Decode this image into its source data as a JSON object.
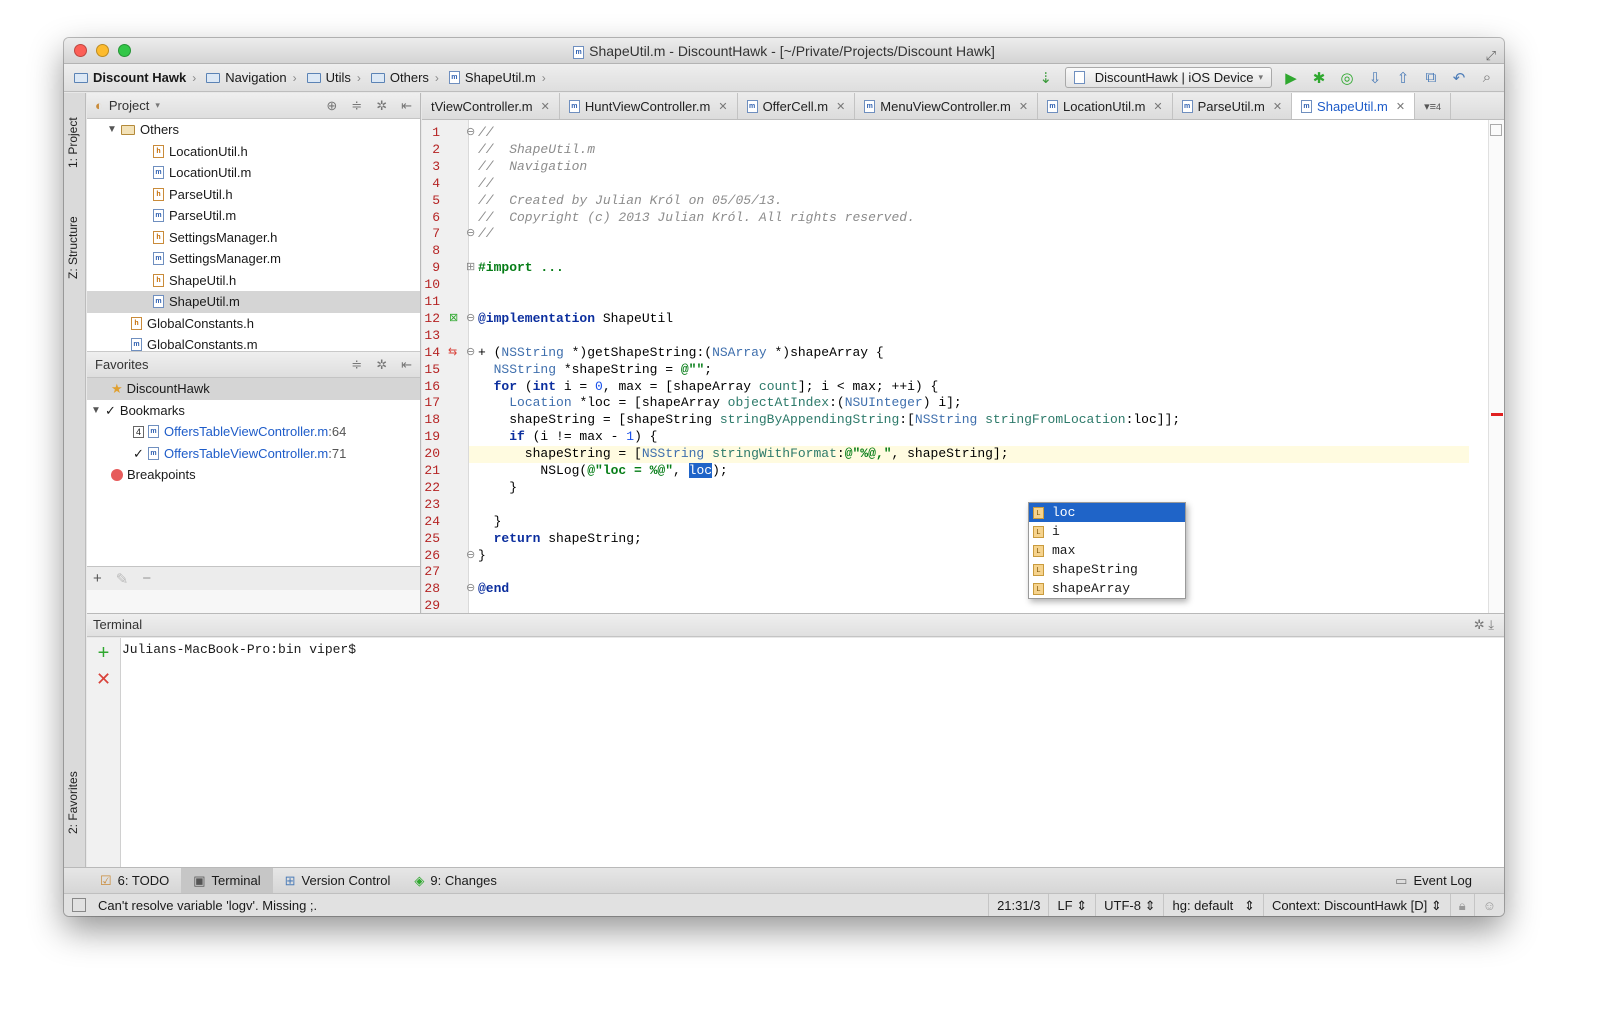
{
  "window": {
    "title": "ShapeUtil.m - DiscountHawk - [~/Private/Projects/Discount Hawk]"
  },
  "breadcrumb": [
    "Discount Hawk",
    "Navigation",
    "Utils",
    "Others",
    "ShapeUtil.m"
  ],
  "run_config": "DiscountHawk | iOS Device",
  "left_strip": {
    "project": "1: Project",
    "structure": "Z: Structure",
    "favorites": "2: Favorites"
  },
  "project_panel": {
    "title": "Project",
    "tree": [
      {
        "label": "Others",
        "kind": "folder",
        "indent": 1
      },
      {
        "label": "LocationUtil.h",
        "kind": "h",
        "indent": 3
      },
      {
        "label": "LocationUtil.m",
        "kind": "m",
        "indent": 3
      },
      {
        "label": "ParseUtil.h",
        "kind": "h",
        "indent": 3
      },
      {
        "label": "ParseUtil.m",
        "kind": "m",
        "indent": 3
      },
      {
        "label": "SettingsManager.h",
        "kind": "h",
        "indent": 3
      },
      {
        "label": "SettingsManager.m",
        "kind": "m",
        "indent": 3
      },
      {
        "label": "ShapeUtil.h",
        "kind": "h",
        "indent": 3
      },
      {
        "label": "ShapeUtil.m",
        "kind": "m",
        "indent": 3,
        "selected": true
      },
      {
        "label": "GlobalConstants.h",
        "kind": "h",
        "indent": 2
      },
      {
        "label": "GlobalConstants.m",
        "kind": "m",
        "indent": 2
      }
    ]
  },
  "favorites_panel": {
    "title": "Favorites",
    "project": "DiscountHawk",
    "bookmarks_label": "Bookmarks",
    "bookmarks": [
      {
        "mark": "4",
        "file": "OffersTableViewController.m",
        "line": ":64"
      },
      {
        "mark": "✓",
        "file": "OffersTableViewController.m",
        "line": ":71"
      }
    ],
    "breakpoints_label": "Breakpoints"
  },
  "tabs": [
    {
      "label": "tViewController.m",
      "active": false
    },
    {
      "label": "HuntViewController.m",
      "active": false
    },
    {
      "label": "OfferCell.m",
      "active": false
    },
    {
      "label": "MenuViewController.m",
      "active": false
    },
    {
      "label": "LocationUtil.m",
      "active": false
    },
    {
      "label": "ParseUtil.m",
      "active": false
    },
    {
      "label": "ShapeUtil.m",
      "active": true
    }
  ],
  "tabs_overflow": "4",
  "code_lines": [
    {
      "n": "1",
      "html": "<span class='cm'>//</span>"
    },
    {
      "n": "2",
      "html": "<span class='cm'>//  ShapeUtil.m</span>"
    },
    {
      "n": "3",
      "html": "<span class='cm'>//  Navigation</span>"
    },
    {
      "n": "4",
      "html": "<span class='cm'>//</span>"
    },
    {
      "n": "5",
      "html": "<span class='cm'>//  Created by Julian Król on 05/05/13.</span>"
    },
    {
      "n": "6",
      "html": "<span class='cm'>//  Copyright (c) 2013 Julian Król. All rights reserved.</span>"
    },
    {
      "n": "7",
      "html": "<span class='cm'>//</span>"
    },
    {
      "n": "8",
      "html": ""
    },
    {
      "n": "9",
      "html": "<span class='st'>#import ...</span>"
    },
    {
      "n": "10",
      "html": ""
    },
    {
      "n": "11",
      "html": ""
    },
    {
      "n": "12",
      "html": "<span class='kw'>@implementation</span> ShapeUtil"
    },
    {
      "n": "13",
      "html": ""
    },
    {
      "n": "14",
      "html": "+ (<span class='ty'>NSString</span> *)getShapeString:(<span class='ty'>NSArray</span> *)shapeArray {"
    },
    {
      "n": "15",
      "html": "  <span class='ty'>NSString</span> *shapeString = <span class='st'>@\"\"</span>;"
    },
    {
      "n": "16",
      "html": "  <span class='kw'>for</span> (<span class='kw'>int</span> i = <span class='nm'>0</span>, max = [shapeArray <span class='mc'>count</span>]; i &lt; max; ++i) {"
    },
    {
      "n": "17",
      "html": "    <span class='ty'>Location</span> *loc = [shapeArray <span class='mc'>objectAtIndex</span>:(<span class='ty'>NSUInteger</span>) i];"
    },
    {
      "n": "18",
      "html": "    shapeString = [shapeString <span class='mc'>stringByAppendingString</span>:[<span class='ty'>NSString</span> <span class='mc'>stringFromLocation</span>:loc]];"
    },
    {
      "n": "19",
      "html": "    <span class='kw'>if</span> (i != max - <span class='nm'>1</span>) {"
    },
    {
      "n": "20",
      "html": "      shapeString = [<span class='ty'>NSString</span> <span class='mc'>stringWithFormat</span>:<span class='st'>@\"%@,\"</span>, shapeString];"
    },
    {
      "n": "21",
      "html": "        NSLog(<span class='st'>@\"loc = %@\"</span>, <span style='background:#1f64c8;color:#fff'>loc</span>);"
    },
    {
      "n": "22",
      "html": "    }"
    },
    {
      "n": "23",
      "html": ""
    },
    {
      "n": "24",
      "html": "  }"
    },
    {
      "n": "25",
      "html": "  <span class='kw'>return</span> shapeString;"
    },
    {
      "n": "26",
      "html": "}"
    },
    {
      "n": "27",
      "html": ""
    },
    {
      "n": "28",
      "html": "<span class='kw'>@end</span>"
    },
    {
      "n": "29",
      "html": ""
    }
  ],
  "completion": [
    "loc",
    "i",
    "max",
    "shapeString",
    "shapeArray"
  ],
  "terminal": {
    "title": "Terminal",
    "prompt": "Julians-MacBook-Pro:bin viper$"
  },
  "bottom_tools": [
    {
      "label": "6: TODO"
    },
    {
      "label": "Terminal",
      "active": true
    },
    {
      "label": "Version Control"
    },
    {
      "label": "9: Changes"
    }
  ],
  "event_log": "Event Log",
  "status": {
    "message": "Can't resolve variable 'logv'. Missing ;.",
    "position": "21:31/3",
    "line_sep": "LF",
    "encoding": "UTF-8",
    "vcs": "hg: default",
    "context": "Context: DiscountHawk [D]"
  }
}
